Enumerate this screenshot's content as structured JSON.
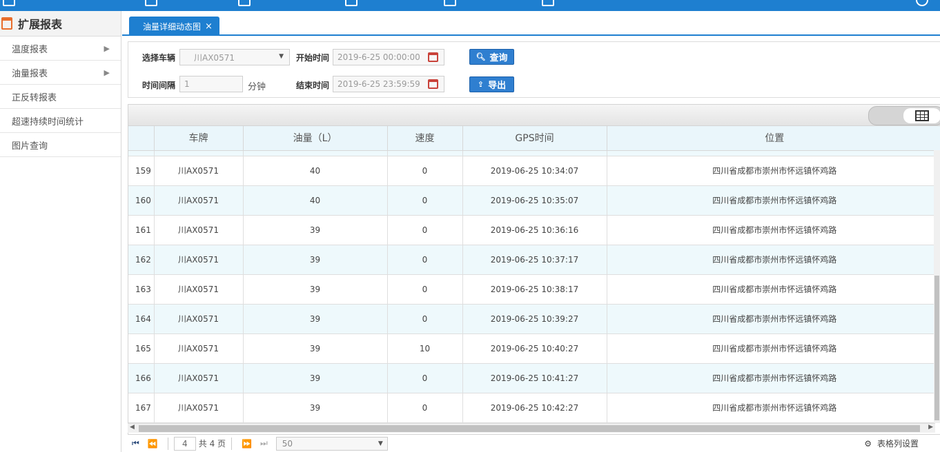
{
  "sidebar": {
    "title": "扩展报表",
    "items": [
      {
        "label": "温度报表",
        "has_arrow": true
      },
      {
        "label": "油量报表",
        "has_arrow": true
      },
      {
        "label": "正反转报表",
        "has_arrow": false
      },
      {
        "label": "超速持续时间统计",
        "has_arrow": false
      },
      {
        "label": "图片查询",
        "has_arrow": false
      }
    ]
  },
  "tabs": [
    {
      "label": "油量详细动态图",
      "close": "×"
    }
  ],
  "filter": {
    "vehicle_label": "选择车辆",
    "vehicle_value": "川AX0571",
    "start_label": "开始时间",
    "start_value": "2019-6-25 00:00:00",
    "interval_label": "时间间隔",
    "interval_value": "1",
    "interval_unit": "分钟",
    "end_label": "结束时间",
    "end_value": "2019-6-25 23:59:59",
    "query_label": "查询",
    "export_label": "导出"
  },
  "table": {
    "columns": [
      "",
      "车牌",
      "油量（L）",
      "速度",
      "GPS时间",
      "位置"
    ],
    "rows": [
      [
        "159",
        "川AX0571",
        "40",
        "0",
        "2019-06-25 10:34:07",
        "四川省成都市崇州市怀远镇怀鸡路"
      ],
      [
        "160",
        "川AX0571",
        "40",
        "0",
        "2019-06-25 10:35:07",
        "四川省成都市崇州市怀远镇怀鸡路"
      ],
      [
        "161",
        "川AX0571",
        "39",
        "0",
        "2019-06-25 10:36:16",
        "四川省成都市崇州市怀远镇怀鸡路"
      ],
      [
        "162",
        "川AX0571",
        "39",
        "0",
        "2019-06-25 10:37:17",
        "四川省成都市崇州市怀远镇怀鸡路"
      ],
      [
        "163",
        "川AX0571",
        "39",
        "0",
        "2019-06-25 10:38:17",
        "四川省成都市崇州市怀远镇怀鸡路"
      ],
      [
        "164",
        "川AX0571",
        "39",
        "0",
        "2019-06-25 10:39:27",
        "四川省成都市崇州市怀远镇怀鸡路"
      ],
      [
        "165",
        "川AX0571",
        "39",
        "10",
        "2019-06-25 10:40:27",
        "四川省成都市崇州市怀远镇怀鸡路"
      ],
      [
        "166",
        "川AX0571",
        "39",
        "0",
        "2019-06-25 10:41:27",
        "四川省成都市崇州市怀远镇怀鸡路"
      ],
      [
        "167",
        "川AX0571",
        "39",
        "0",
        "2019-06-25 10:42:27",
        "四川省成都市崇州市怀远镇怀鸡路"
      ]
    ]
  },
  "pager": {
    "page_value": "4",
    "total_text": "共 4 页",
    "page_size": "50",
    "settings_label": "表格列设置"
  },
  "colors": {
    "primary": "#1e7fd0",
    "row_alt": "#eef9fc",
    "header_bg": "#eaf6fb"
  }
}
